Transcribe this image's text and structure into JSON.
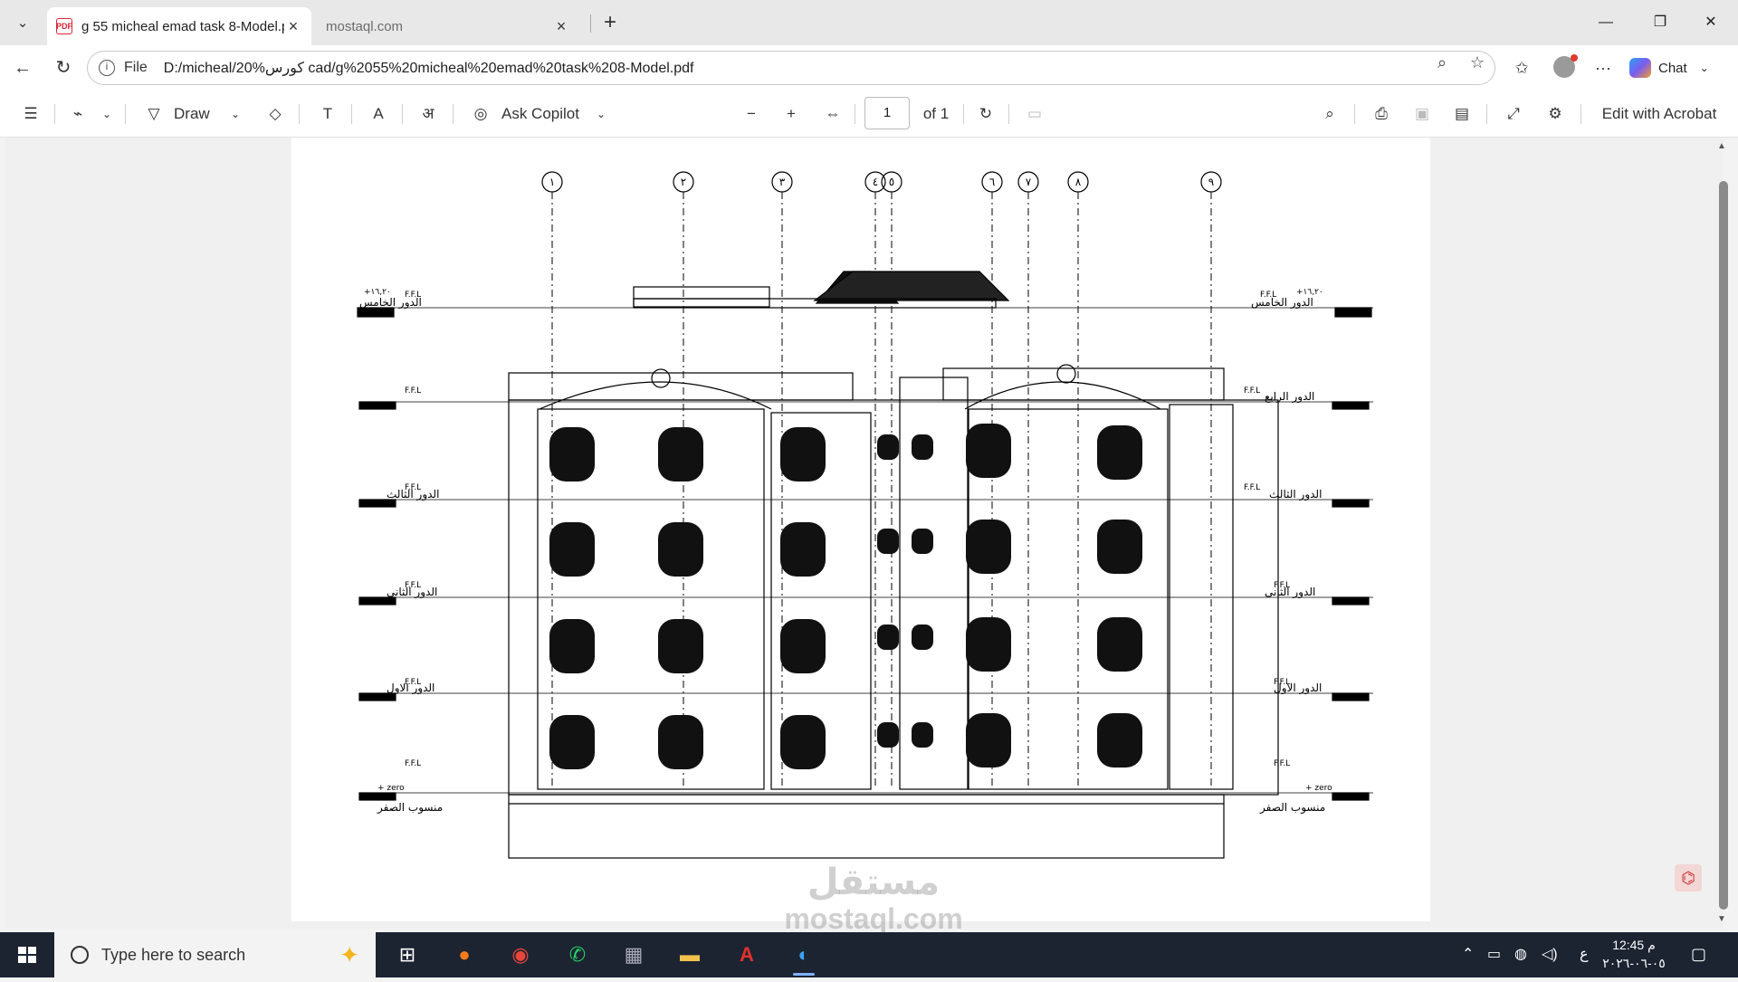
{
  "browser": {
    "tabs": [
      {
        "title": "g 55 micheal emad task 8-Model.p",
        "favicon": "PDF",
        "active": true
      },
      {
        "title": "mostaql.com",
        "favicon": "",
        "active": false
      }
    ],
    "url_scheme": "File",
    "url": "D:/micheal/20%كورس cad/g%2055%20micheal%20emad%20task%208-Model.pdf",
    "chat_label": "Chat"
  },
  "pdf_toolbar": {
    "draw_label": "Draw",
    "copilot_label": "Ask Copilot",
    "page_current": "1",
    "page_total": "of 1",
    "acrobat_label": "Edit with Acrobat"
  },
  "drawing": {
    "grid_labels": [
      "١",
      "٢",
      "٣",
      "٤",
      "٥",
      "٦",
      "٧",
      "٨",
      "٩"
    ],
    "level_prefix": "F.F.L",
    "roof_level": "+١٦,٢٠",
    "zero_level": "+ zero",
    "floors_left": [
      "الدور الخامس",
      "الدور الثالث",
      "الدور الثانى",
      "الدور الاول",
      "منسوب الصفر"
    ],
    "floors_right": [
      "الدور الخامس",
      "الدور الرابع",
      "الدور الثالث",
      "الدور الثانى",
      "الدور الاول",
      "منسوب الصفر"
    ]
  },
  "watermark": {
    "line1": "مستقل",
    "line2": "mostaql.com"
  },
  "taskbar": {
    "search_placeholder": "Type here to search",
    "lang": "ع",
    "time": "12:45 م",
    "date": "٠٥-٠٦-٢٠٢٦"
  }
}
